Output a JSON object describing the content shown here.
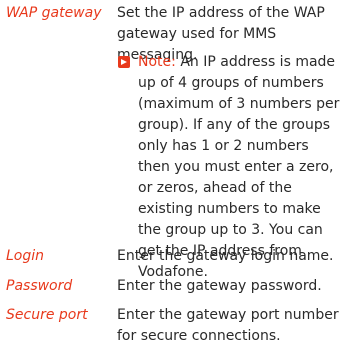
{
  "entries": [
    {
      "term": "WAP gateway",
      "definition": "Set the IP address of the WAP gateway used for MMS messaging.",
      "note_label": "Note:",
      "note_text": "An IP address is made up of 4 groups of numbers (maximum of 3 numbers per group). If any of the groups only has 1 or 2 numbers then you must enter a zero, or zeros, ahead of the existing numbers to make the group up to 3. You can get the IP address from Vodafone."
    },
    {
      "term": "Login",
      "definition": "Enter the gateway login name."
    },
    {
      "term": "Password",
      "definition": "Enter the gateway password."
    },
    {
      "term": "Secure port",
      "definition": "Enter the gateway port number for secure connections."
    }
  ],
  "colors": {
    "accent": "#e8391c",
    "text": "#2a2a2a"
  },
  "icons": {
    "note": "note-arrow-icon"
  }
}
